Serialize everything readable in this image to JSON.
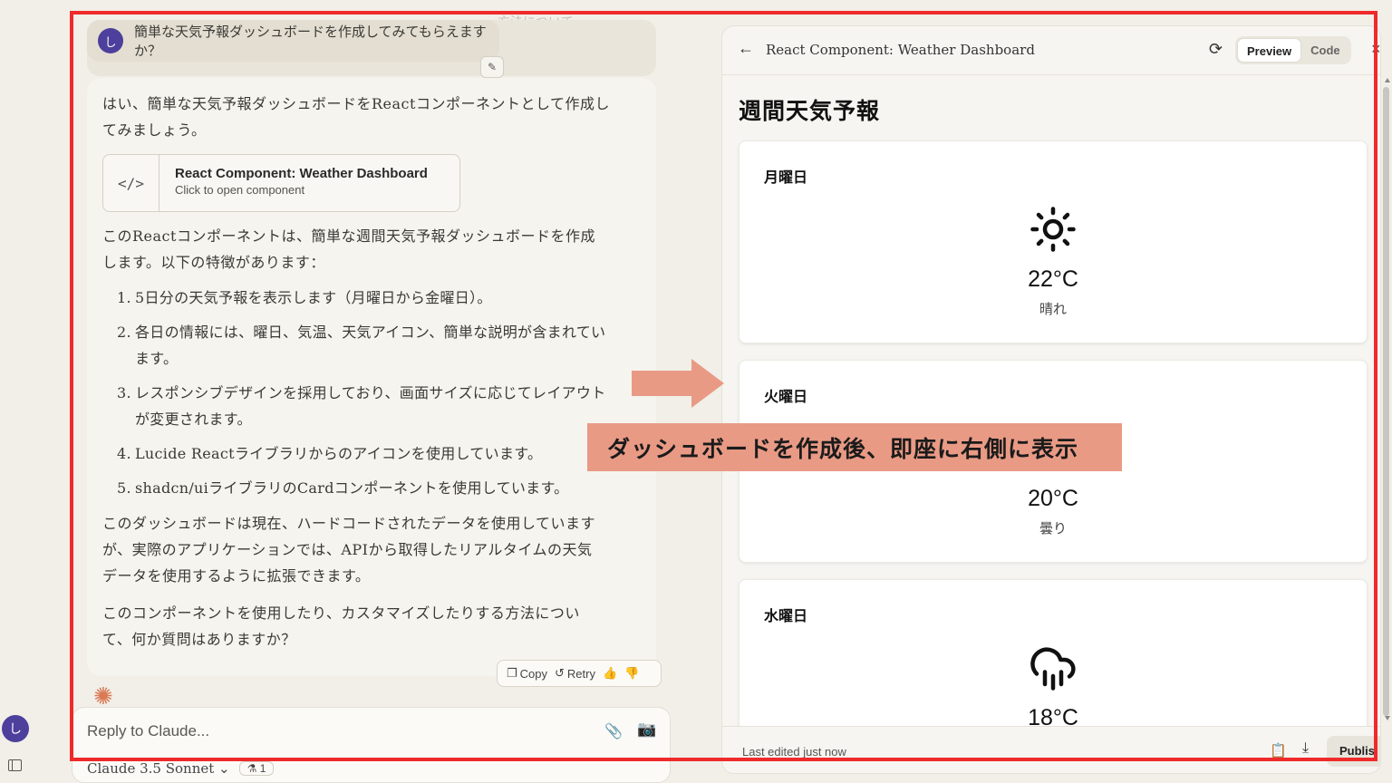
{
  "sidebar": {
    "avatar_initial": "し"
  },
  "chat": {
    "ghost_text": "方法について",
    "user_message": "簡単な天気予報ダッシュボードを作成してみてもらえますか？",
    "intro": "はい、簡単な天気予報ダッシュボードをReactコンポーネントとして作成してみましょう。",
    "artifact": {
      "title": "React Component: Weather Dashboard",
      "subtitle": "Click to open component",
      "icon": "</>"
    },
    "description": "このReactコンポーネントは、簡単な週間天気予報ダッシュボードを作成します。以下の特徴があります：",
    "features": [
      {
        "num": "1.",
        "text": "5日分の天気予報を表示します（月曜日から金曜日）。"
      },
      {
        "num": "2.",
        "text": "各日の情報には、曜日、気温、天気アイコン、簡単な説明が含まれています。"
      },
      {
        "num": "3.",
        "text": "レスポンシブデザインを採用しており、画面サイズに応じてレイアウトが変更されます。"
      },
      {
        "num": "4.",
        "text": "Lucide Reactライブラリからのアイコンを使用しています。"
      },
      {
        "num": "5.",
        "text": "shadcn/uiライブラリのCardコンポーネントを使用しています。"
      }
    ],
    "closing_1": "このダッシュボードは現在、ハードコードされたデータを使用していますが、実際のアプリケーションでは、APIから取得したリアルタイムの天気データを使用するように拡張できます。",
    "closing_2": "このコンポーネントを使用したり、カスタマイズしたりする方法について、何か質問はありますか？",
    "actions": {
      "copy": "Copy",
      "retry": "Retry"
    },
    "reply_placeholder": "Reply to Claude...",
    "model_name": "Claude 3.5 Sonnet",
    "badge_count": "1"
  },
  "panel": {
    "title": "React Component: Weather Dashboard",
    "tabs": {
      "preview": "Preview",
      "code": "Code"
    },
    "heading": "週間天気予報",
    "days": [
      {
        "name": "月曜日",
        "temp": "22°C",
        "desc": "晴れ",
        "icon": "sun-icon"
      },
      {
        "name": "火曜日",
        "temp": "20°C",
        "desc": "曇り",
        "icon": "cloud-icon"
      },
      {
        "name": "水曜日",
        "temp": "18°C",
        "desc": "",
        "icon": "cloud-rain-icon"
      }
    ],
    "footer": {
      "edited": "Last edited just now",
      "publish": "Publis"
    }
  },
  "annotation": {
    "banner": "ダッシュボードを作成後、即座に右側に表示"
  },
  "colors": {
    "frame": "#ef2a2a",
    "banner": "#e99a85",
    "accent": "#4d3f9c"
  }
}
